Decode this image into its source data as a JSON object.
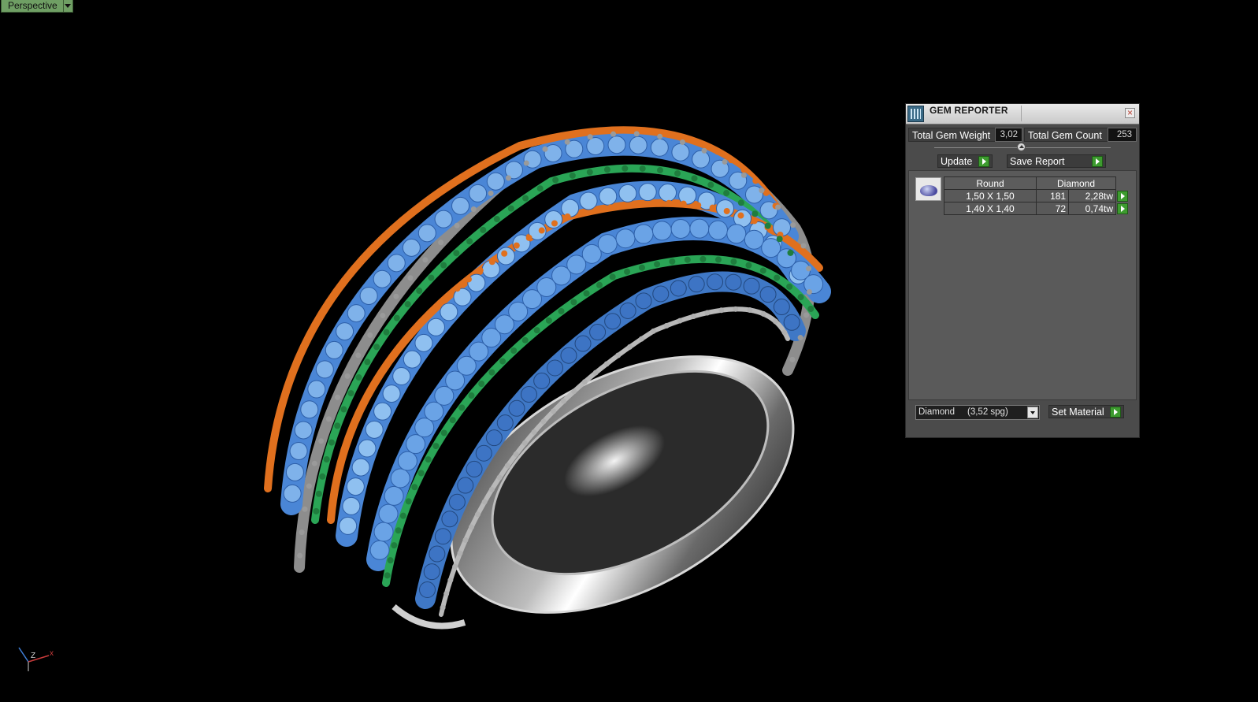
{
  "viewport": {
    "view_name": "Perspective",
    "axis_labels": {
      "z": "Z",
      "x": "x"
    }
  },
  "gem_reporter": {
    "title": "GEM REPORTER",
    "total_gem_weight_label": "Total Gem Weight",
    "total_gem_weight_value": "3,02",
    "total_gem_count_label": "Total Gem Count",
    "total_gem_count_value": "253",
    "update_label": "Update",
    "save_report_label": "Save Report",
    "table": {
      "headers": [
        "Round",
        "Diamond"
      ],
      "rows": [
        {
          "size": "1,50 X 1,50",
          "count": "181",
          "weight": "2,28tw"
        },
        {
          "size": "1,40 X 1,40",
          "count": "72",
          "weight": "0,74tw"
        }
      ]
    },
    "material_select_value": "Diamond     (3,52 spg)",
    "set_material_label": "Set Material"
  },
  "colors": {
    "viewport_label_bg": "#6f9f64",
    "panel_bg": "#4b4b4b",
    "go_button": "#3d9b2f",
    "prong_orange": "#e0701e",
    "band_green": "#2aa556",
    "gem_blue": "#4a86d6",
    "metal_silver": "#b9b9b9"
  }
}
